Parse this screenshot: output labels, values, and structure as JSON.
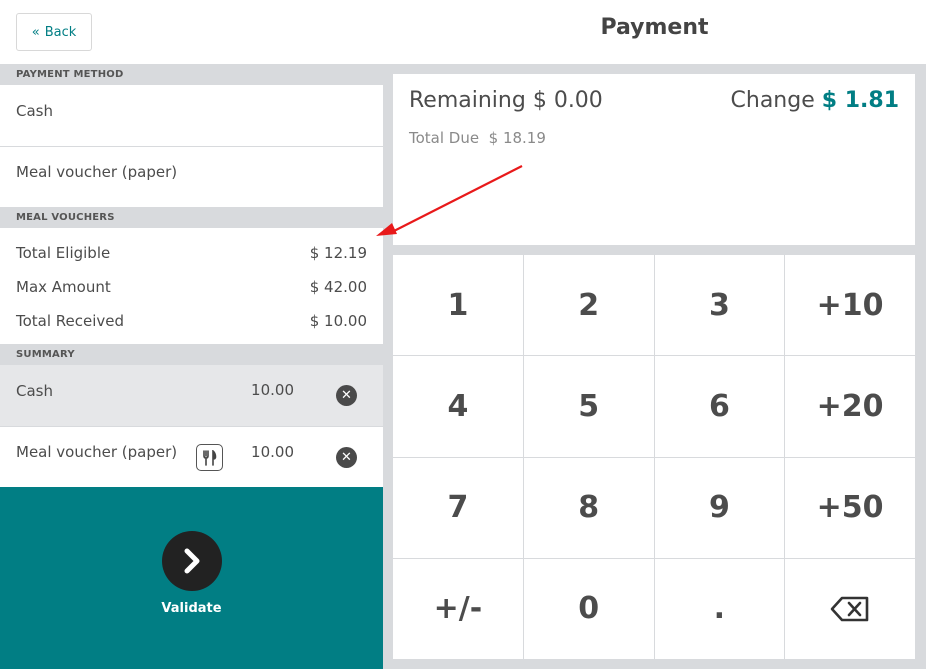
{
  "header": {
    "back_label": "Back",
    "title": "Payment"
  },
  "payment_method": {
    "heading": "PAYMENT METHOD",
    "methods": [
      "Cash",
      "Meal voucher (paper)"
    ]
  },
  "meal_vouchers": {
    "heading": "MEAL VOUCHERS",
    "rows": [
      {
        "label": "Total Eligible",
        "value": "$ 12.19"
      },
      {
        "label": "Max Amount",
        "value": "$ 42.00"
      },
      {
        "label": "Total Received",
        "value": "$ 10.00"
      }
    ]
  },
  "summary": {
    "heading": "SUMMARY",
    "lines": [
      {
        "name": "Cash",
        "amount": "10.00"
      },
      {
        "name": "Meal voucher (paper)",
        "amount": "10.00"
      }
    ]
  },
  "validate": {
    "label": "Validate"
  },
  "status": {
    "remaining_label": "Remaining",
    "remaining_value": "$ 0.00",
    "change_label": "Change",
    "change_value": "$ 1.81",
    "total_due_label": "Total Due",
    "total_due_value": "$ 18.19"
  },
  "numpad": {
    "keys": [
      "1",
      "2",
      "3",
      "+10",
      "4",
      "5",
      "6",
      "+20",
      "7",
      "8",
      "9",
      "+50",
      "+/-",
      "0",
      "."
    ]
  },
  "colors": {
    "accent": "#017e84",
    "annotation_arrow": "#e8191a"
  }
}
